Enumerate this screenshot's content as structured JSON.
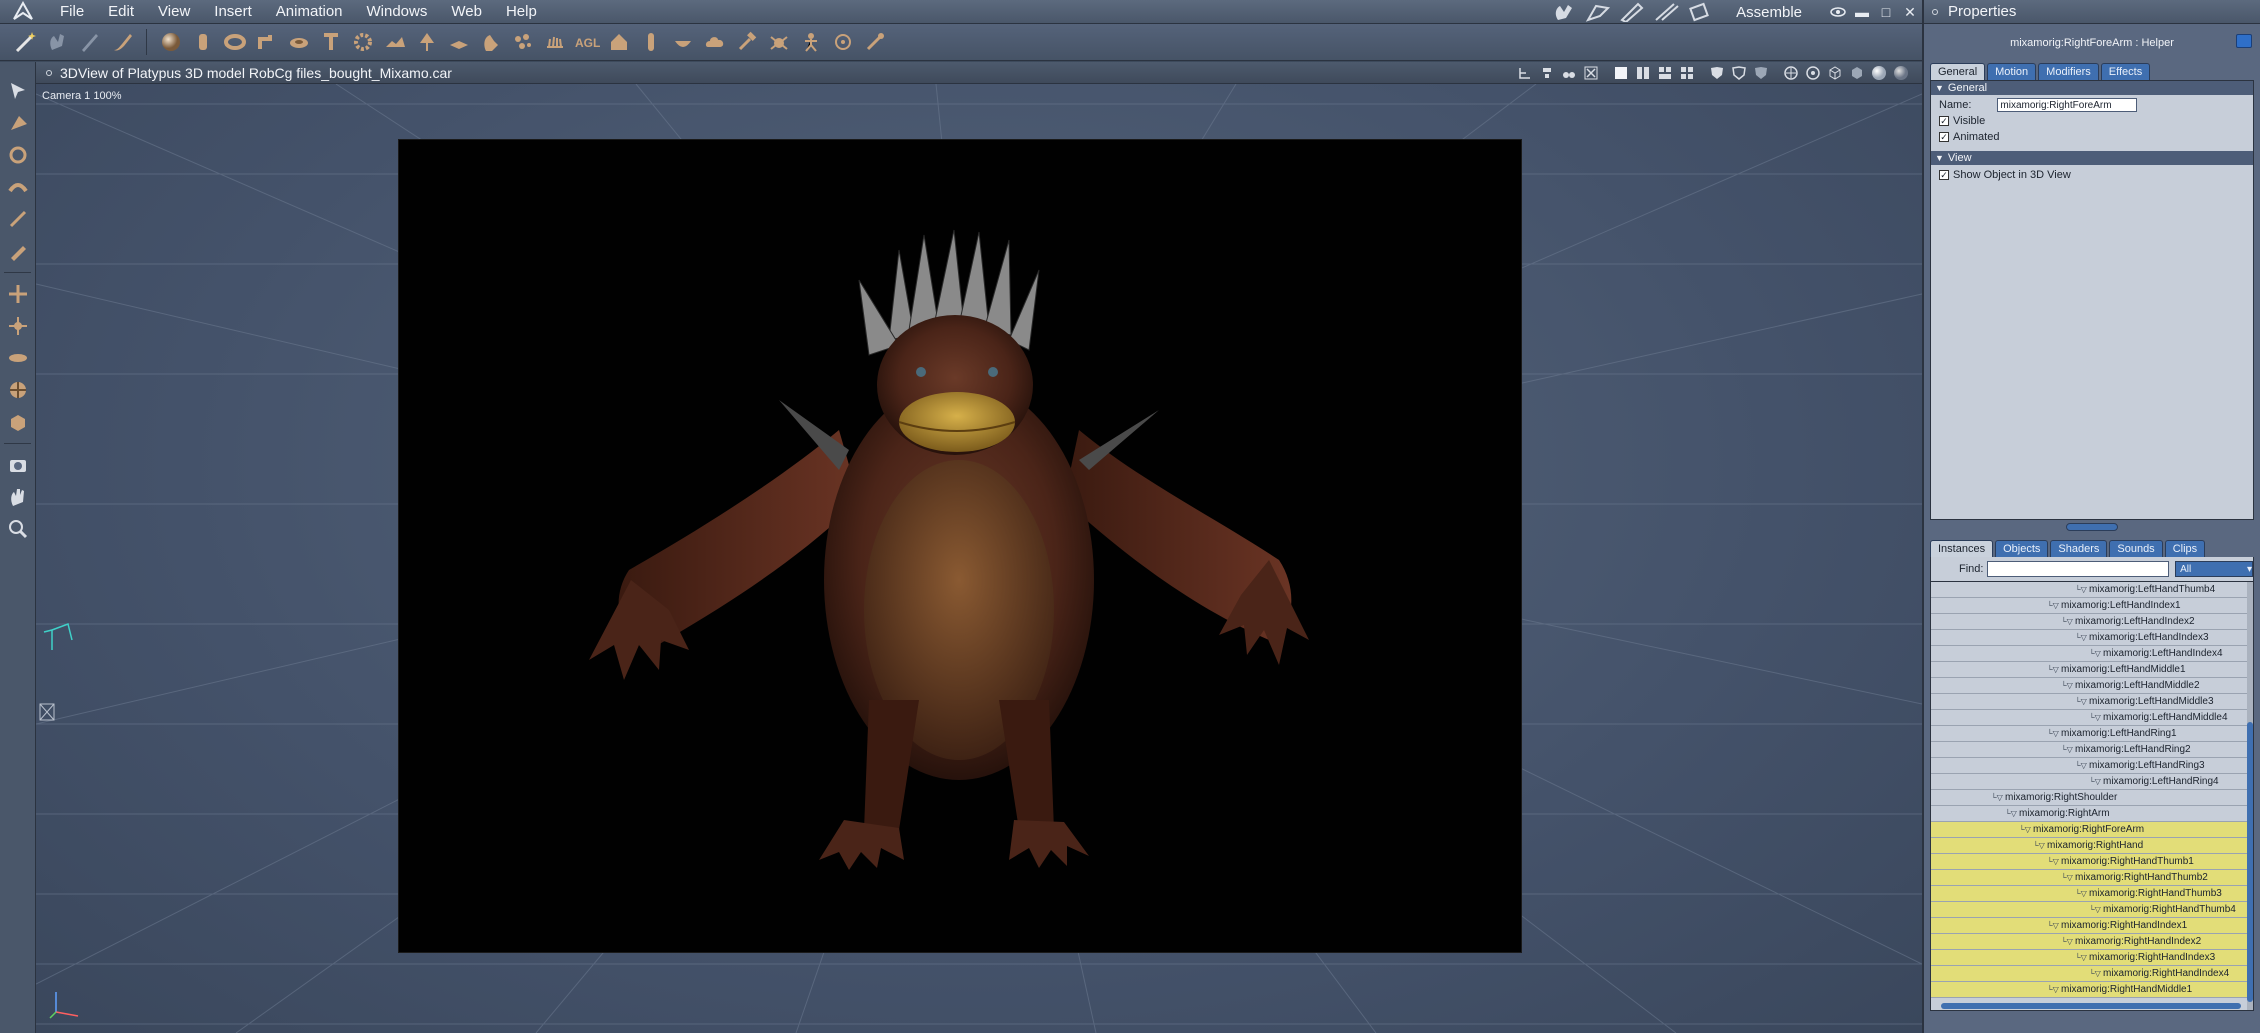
{
  "menubar": {
    "items": [
      "File",
      "Edit",
      "View",
      "Insert",
      "Animation",
      "Windows",
      "Web",
      "Help"
    ],
    "room": "Assemble"
  },
  "viewport": {
    "title": "3DView of Platypus 3D model RobCg files_bought_Mixamo.car",
    "camera": "Camera 1 100%"
  },
  "properties": {
    "title": "Properties",
    "object": "mixamorig:RightForeArm : Helper",
    "tabs": [
      "General",
      "Motion",
      "Modifiers",
      "Effects"
    ],
    "general_section": "General",
    "name_label": "Name:",
    "name_value": "mixamorig:RightForeArm",
    "visible_label": "Visible",
    "animated_label": "Animated",
    "view_section": "View",
    "show_in_3d_label": "Show Object in 3D View"
  },
  "browser": {
    "tabs": [
      "Instances",
      "Objects",
      "Shaders",
      "Sounds",
      "Clips"
    ],
    "find_label": "Find:",
    "filter_value": "All",
    "tree": [
      {
        "label": "mixamorig:LeftHandThumb4",
        "depth": 7,
        "selected": false
      },
      {
        "label": "mixamorig:LeftHandIndex1",
        "depth": 5,
        "selected": false
      },
      {
        "label": "mixamorig:LeftHandIndex2",
        "depth": 6,
        "selected": false
      },
      {
        "label": "mixamorig:LeftHandIndex3",
        "depth": 7,
        "selected": false
      },
      {
        "label": "mixamorig:LeftHandIndex4",
        "depth": 8,
        "selected": false
      },
      {
        "label": "mixamorig:LeftHandMiddle1",
        "depth": 5,
        "selected": false
      },
      {
        "label": "mixamorig:LeftHandMiddle2",
        "depth": 6,
        "selected": false
      },
      {
        "label": "mixamorig:LeftHandMiddle3",
        "depth": 7,
        "selected": false
      },
      {
        "label": "mixamorig:LeftHandMiddle4",
        "depth": 8,
        "selected": false
      },
      {
        "label": "mixamorig:LeftHandRing1",
        "depth": 5,
        "selected": false
      },
      {
        "label": "mixamorig:LeftHandRing2",
        "depth": 6,
        "selected": false
      },
      {
        "label": "mixamorig:LeftHandRing3",
        "depth": 7,
        "selected": false
      },
      {
        "label": "mixamorig:LeftHandRing4",
        "depth": 8,
        "selected": false
      },
      {
        "label": "mixamorig:RightShoulder",
        "depth": 1,
        "selected": false
      },
      {
        "label": "mixamorig:RightArm",
        "depth": 2,
        "selected": false
      },
      {
        "label": "mixamorig:RightForeArm",
        "depth": 3,
        "selected": true
      },
      {
        "label": "mixamorig:RightHand",
        "depth": 4,
        "selected": true
      },
      {
        "label": "mixamorig:RightHandThumb1",
        "depth": 5,
        "selected": true
      },
      {
        "label": "mixamorig:RightHandThumb2",
        "depth": 6,
        "selected": true
      },
      {
        "label": "mixamorig:RightHandThumb3",
        "depth": 7,
        "selected": true
      },
      {
        "label": "mixamorig:RightHandThumb4",
        "depth": 8,
        "selected": true
      },
      {
        "label": "mixamorig:RightHandIndex1",
        "depth": 5,
        "selected": true
      },
      {
        "label": "mixamorig:RightHandIndex2",
        "depth": 6,
        "selected": true
      },
      {
        "label": "mixamorig:RightHandIndex3",
        "depth": 7,
        "selected": true
      },
      {
        "label": "mixamorig:RightHandIndex4",
        "depth": 8,
        "selected": true
      },
      {
        "label": "mixamorig:RightHandMiddle1",
        "depth": 5,
        "selected": true
      }
    ]
  },
  "colors": {
    "selection": "#e2dd78",
    "accent": "#3f6fb0",
    "chrome": "#4a576a"
  }
}
